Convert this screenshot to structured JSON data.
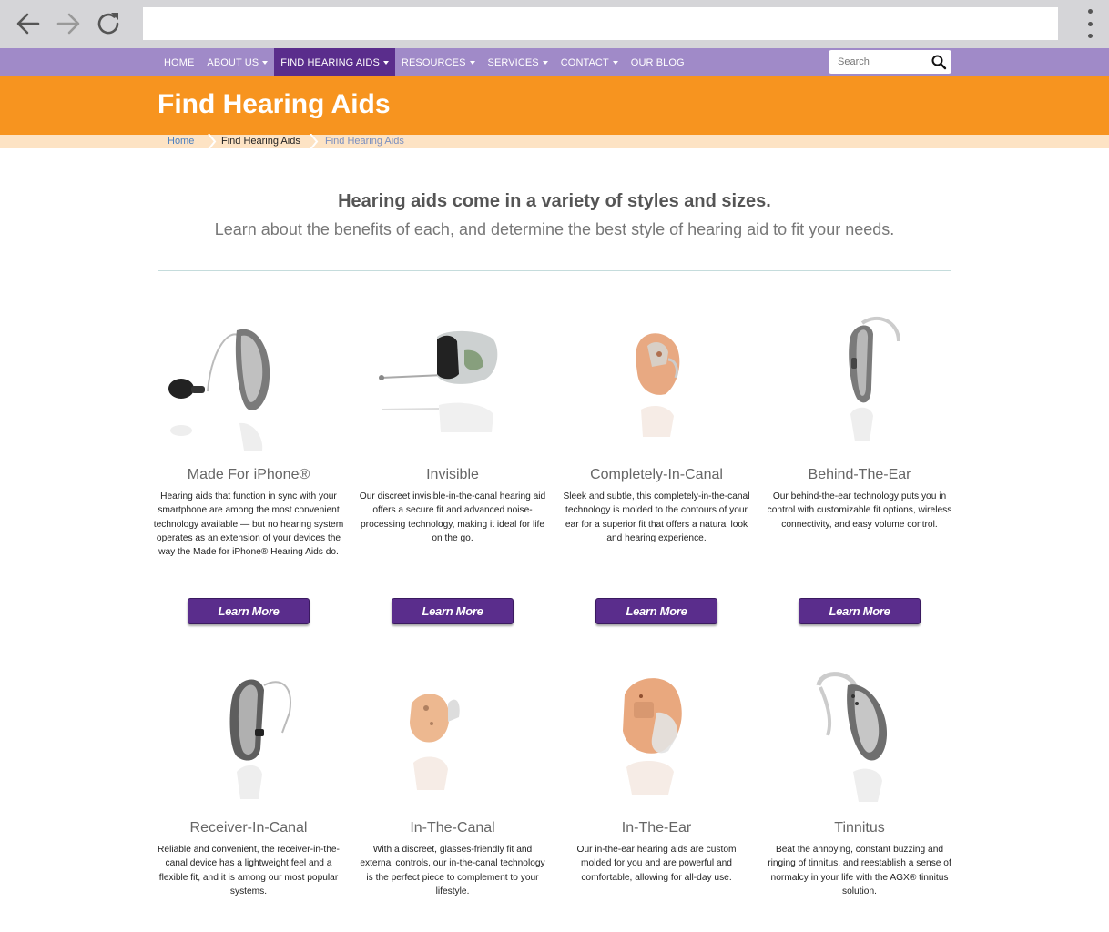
{
  "browser": {
    "back_icon": "arrow-left-icon",
    "forward_icon": "arrow-right-icon",
    "reload_icon": "reload-icon",
    "menu_icon": "kebab-menu-icon",
    "url": ""
  },
  "nav": {
    "items": [
      {
        "label": "HOME",
        "dropdown": false
      },
      {
        "label": "ABOUT US",
        "dropdown": true
      },
      {
        "label": "FIND HEARING AIDS",
        "dropdown": true,
        "active": true
      },
      {
        "label": "RESOURCES",
        "dropdown": true
      },
      {
        "label": "SERVICES",
        "dropdown": true
      },
      {
        "label": "CONTACT",
        "dropdown": true
      },
      {
        "label": "OUR BLOG",
        "dropdown": false
      }
    ],
    "search_placeholder": "Search",
    "search_icon": "magnifier-icon"
  },
  "colors": {
    "nav_bg": "#a08ac8",
    "nav_active": "#5a2d8c",
    "banner": "#f7941f",
    "breadcrumb_bg": "#fde3c4",
    "button": "#5a2d8c"
  },
  "banner": {
    "title": "Find Hearing Aids"
  },
  "breadcrumb": [
    "Home",
    "Find Hearing Aids",
    "Find Hearing Aids"
  ],
  "intro": {
    "heading": "Hearing aids come in a variety of styles and sizes.",
    "subheading": "Learn about the benefits of each, and determine the best style of hearing aid to fit your needs."
  },
  "products": [
    {
      "title": "Made For iPhone®",
      "text": "Hearing aids that function in sync with your smartphone are among the most convenient technology available — but no hearing system operates as an extension of your devices the way the Made for iPhone® Hearing Aids do.",
      "button": "Learn More"
    },
    {
      "title": "Invisible",
      "text": "Our discreet invisible-in-the-canal hearing aid offers a secure fit and advanced noise-processing technology, making it ideal for life on the go.",
      "button": "Learn More"
    },
    {
      "title": "Completely-In-Canal",
      "text": "Sleek and subtle, this completely-in-the-canal technology is molded to the contours of your ear for a superior fit that offers a natural look and hearing experience.",
      "button": "Learn More"
    },
    {
      "title": "Behind-The-Ear",
      "text": "Our behind-the-ear technology puts you in control with customizable fit options, wireless connectivity, and easy volume control.",
      "button": "Learn More"
    },
    {
      "title": "Receiver-In-Canal",
      "text": "Reliable and convenient, the receiver-in-the-canal device has a lightweight feel and a flexible fit, and it is among our most popular systems."
    },
    {
      "title": "In-The-Canal",
      "text": "With a discreet, glasses-friendly fit and external controls, our in-the-canal technology is the perfect piece to complement to your lifestyle."
    },
    {
      "title": "In-The-Ear",
      "text": "Our in-the-ear hearing aids are custom molded for you and are powerful and comfortable, allowing for all-day use."
    },
    {
      "title": "Tinnitus",
      "text": "Beat the annoying, constant buzzing and ringing of tinnitus, and reestablish a sense of normalcy in your life with the AGX® tinnitus solution."
    }
  ]
}
